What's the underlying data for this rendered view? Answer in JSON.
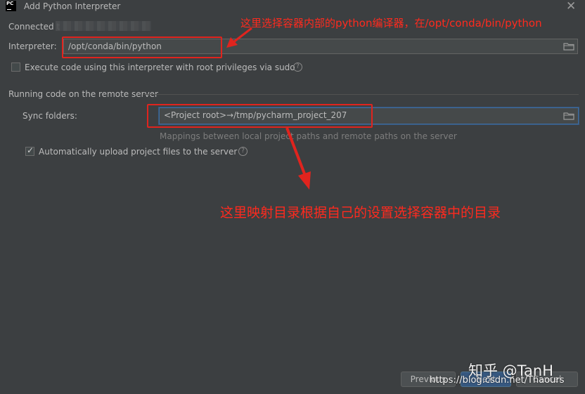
{
  "dialog": {
    "title": "Add Python Interpreter",
    "logo_text": "PC",
    "close_glyph": "✕"
  },
  "connection": {
    "label": "Connected t"
  },
  "interpreter": {
    "label": "Interpreter:",
    "value": "/opt/conda/bin/python"
  },
  "sudo_option": {
    "label": "Execute code using this interpreter with root privileges via sudo",
    "checked": false,
    "help_glyph": "?"
  },
  "remote_section": {
    "title": "Running code on the remote server",
    "sync_label": "Sync folders:",
    "sync_value": "<Project root>→/tmp/pycharm_project_207",
    "sync_hint": "Mappings between local project paths and remote paths on the server",
    "auto_upload_label": "Automatically upload project files to the server",
    "auto_upload_checked": true,
    "help_glyph": "?"
  },
  "annotations": {
    "note1": "这里选择容器内部的python编译器，在/opt/conda/bin/python",
    "note2": "这里映射目录根据自己的设置选择容器中的目录",
    "color": "#ff2a1e"
  },
  "footer": {
    "previous_label": "Previous",
    "next_label": "Next",
    "cancel_label": "Cancel"
  },
  "watermarks": {
    "zhihu": "知乎 @TanH",
    "csdn": "https://blog.csdn.net/Thaours"
  },
  "colors": {
    "background": "#3c3f41",
    "input_bg": "#45494a",
    "text": "#bbbbbb",
    "annotation_red": "#e0241e"
  },
  "icons": {
    "folder": "folder-icon",
    "help": "help-icon",
    "close": "close-icon",
    "arrow": "red-arrow"
  }
}
